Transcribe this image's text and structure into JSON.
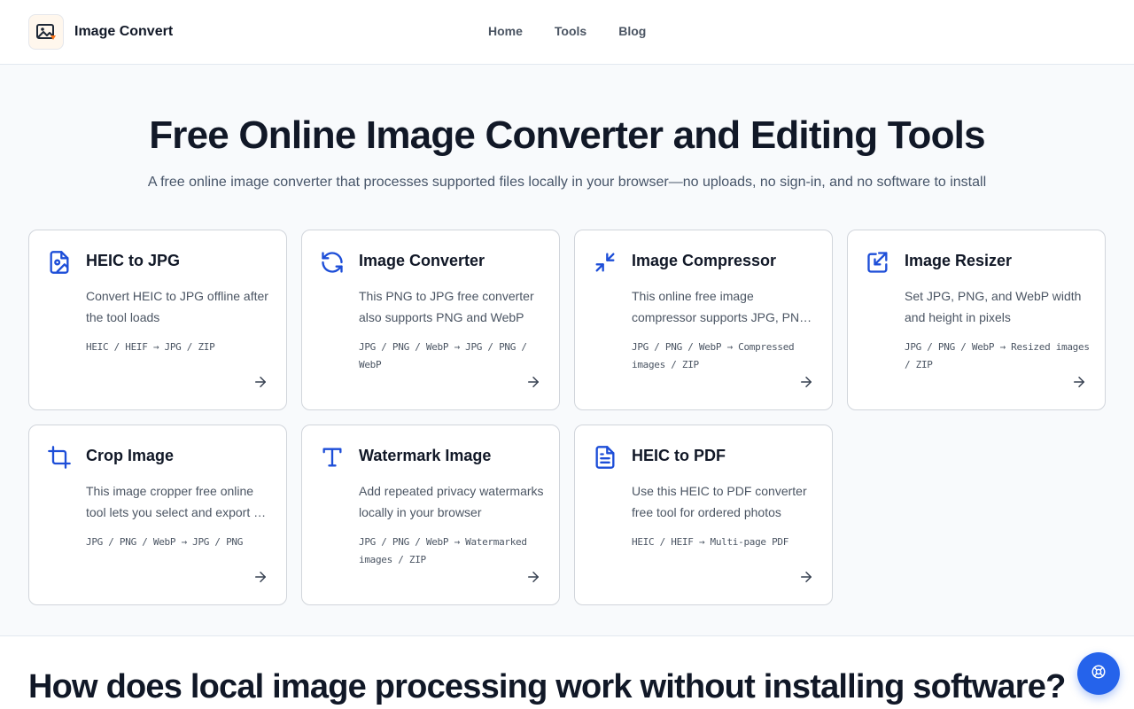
{
  "brand": {
    "name": "Image Convert",
    "logo_icon": "image-icon"
  },
  "nav": {
    "items": [
      "Home",
      "Tools",
      "Blog"
    ]
  },
  "hero": {
    "title": "Free Online Image Converter and Editing Tools",
    "subtitle": "A free online image converter that processes supported files locally in your browser—no uploads, no sign-in, and no software to install"
  },
  "tools": [
    {
      "title": "HEIC to JPG",
      "desc": "Convert HEIC to JPG offline after the tool loads",
      "formats": "HEIC / HEIF → JPG / ZIP",
      "icon": "file-image-icon"
    },
    {
      "title": "Image Converter",
      "desc": "This PNG to JPG free converter also supports PNG and WebP",
      "formats": "JPG / PNG / WebP → JPG / PNG / WebP",
      "icon": "refresh-icon"
    },
    {
      "title": "Image Compressor",
      "desc": "This online free image compressor supports JPG, PNG, and WebP",
      "formats": "JPG / PNG / WebP → Compressed images / ZIP",
      "icon": "minimize-icon"
    },
    {
      "title": "Image Resizer",
      "desc": "Set JPG, PNG, and WebP width and height in pixels",
      "formats": "JPG / PNG / WebP → Resized images / ZIP",
      "icon": "resize-icon"
    },
    {
      "title": "Crop Image",
      "desc": "This image cropper free online tool lets you select and export a region",
      "formats": "JPG / PNG / WebP → JPG / PNG",
      "icon": "crop-icon"
    },
    {
      "title": "Watermark Image",
      "desc": "Add repeated privacy watermarks locally in your browser",
      "formats": "JPG / PNG / WebP → Watermarked images / ZIP",
      "icon": "type-icon"
    },
    {
      "title": "HEIC to PDF",
      "desc": "Use this HEIC to PDF converter free tool for ordered photos",
      "formats": "HEIC / HEIF → Multi-page PDF",
      "icon": "file-text-icon"
    }
  ],
  "section2": {
    "title": "How does local image processing work without installing software?"
  },
  "colors": {
    "accent": "#1d4ed8",
    "fab": "#2563eb",
    "text": "#111827",
    "muted": "#4b5563"
  }
}
